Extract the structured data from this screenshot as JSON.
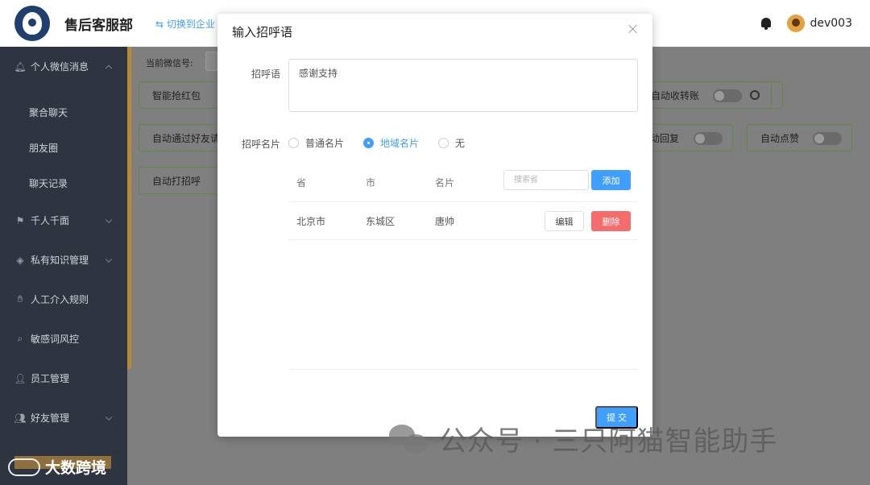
{
  "header": {
    "brand": "售后客服部",
    "switch_label": "⇆ 切换到企业",
    "username": "dev003"
  },
  "sidebar": {
    "items": [
      {
        "label": "个人微信消息",
        "icon": "bell-icon"
      },
      {
        "label": "聚合聊天"
      },
      {
        "label": "朋友圈"
      },
      {
        "label": "聊天记录"
      },
      {
        "label": "千人千面",
        "icon": "flag-icon"
      },
      {
        "label": "私有知识管理",
        "icon": "tag-icon"
      },
      {
        "label": "人工介入规则",
        "icon": "hand-icon"
      },
      {
        "label": "敏感词风控",
        "icon": "search-icon"
      },
      {
        "label": "员工管理",
        "icon": "user-add-icon"
      },
      {
        "label": "好友管理",
        "icon": "users-icon"
      }
    ]
  },
  "main": {
    "wx_label": "当前微信号:",
    "features": {
      "red_packet": "智能抢红包",
      "auto_transfer": "自动收转账",
      "auto_accept_friend": "自动通过好友请",
      "auto_reply": "动回复",
      "auto_like": "自动点赞",
      "auto_greet": "自动打招呼"
    }
  },
  "dialog": {
    "title": "输入招呼语",
    "greeting_label": "招呼语",
    "greeting_value": "感谢支持",
    "card_label": "招呼名片",
    "radio_options": [
      "普通名片",
      "地域名片",
      "无"
    ],
    "selected_option": "地域名片",
    "table": {
      "headers": {
        "province": "省",
        "city": "市",
        "card": "名片"
      },
      "search_placeholder": "搜索省",
      "add_label": "添加",
      "rows": [
        {
          "province": "北京市",
          "city": "东城区",
          "card": "唐帅",
          "edit": "编辑",
          "delete": "删除"
        }
      ]
    },
    "submit_label": "提 交"
  },
  "watermark": {
    "main": "公众号 · 三只阿猫智能助手",
    "bottom": "大数跨境"
  },
  "colors": {
    "primary": "#409eff",
    "danger": "#f56c6c",
    "sidebar_bg": "#2f3441",
    "accent": "#b8893a"
  }
}
